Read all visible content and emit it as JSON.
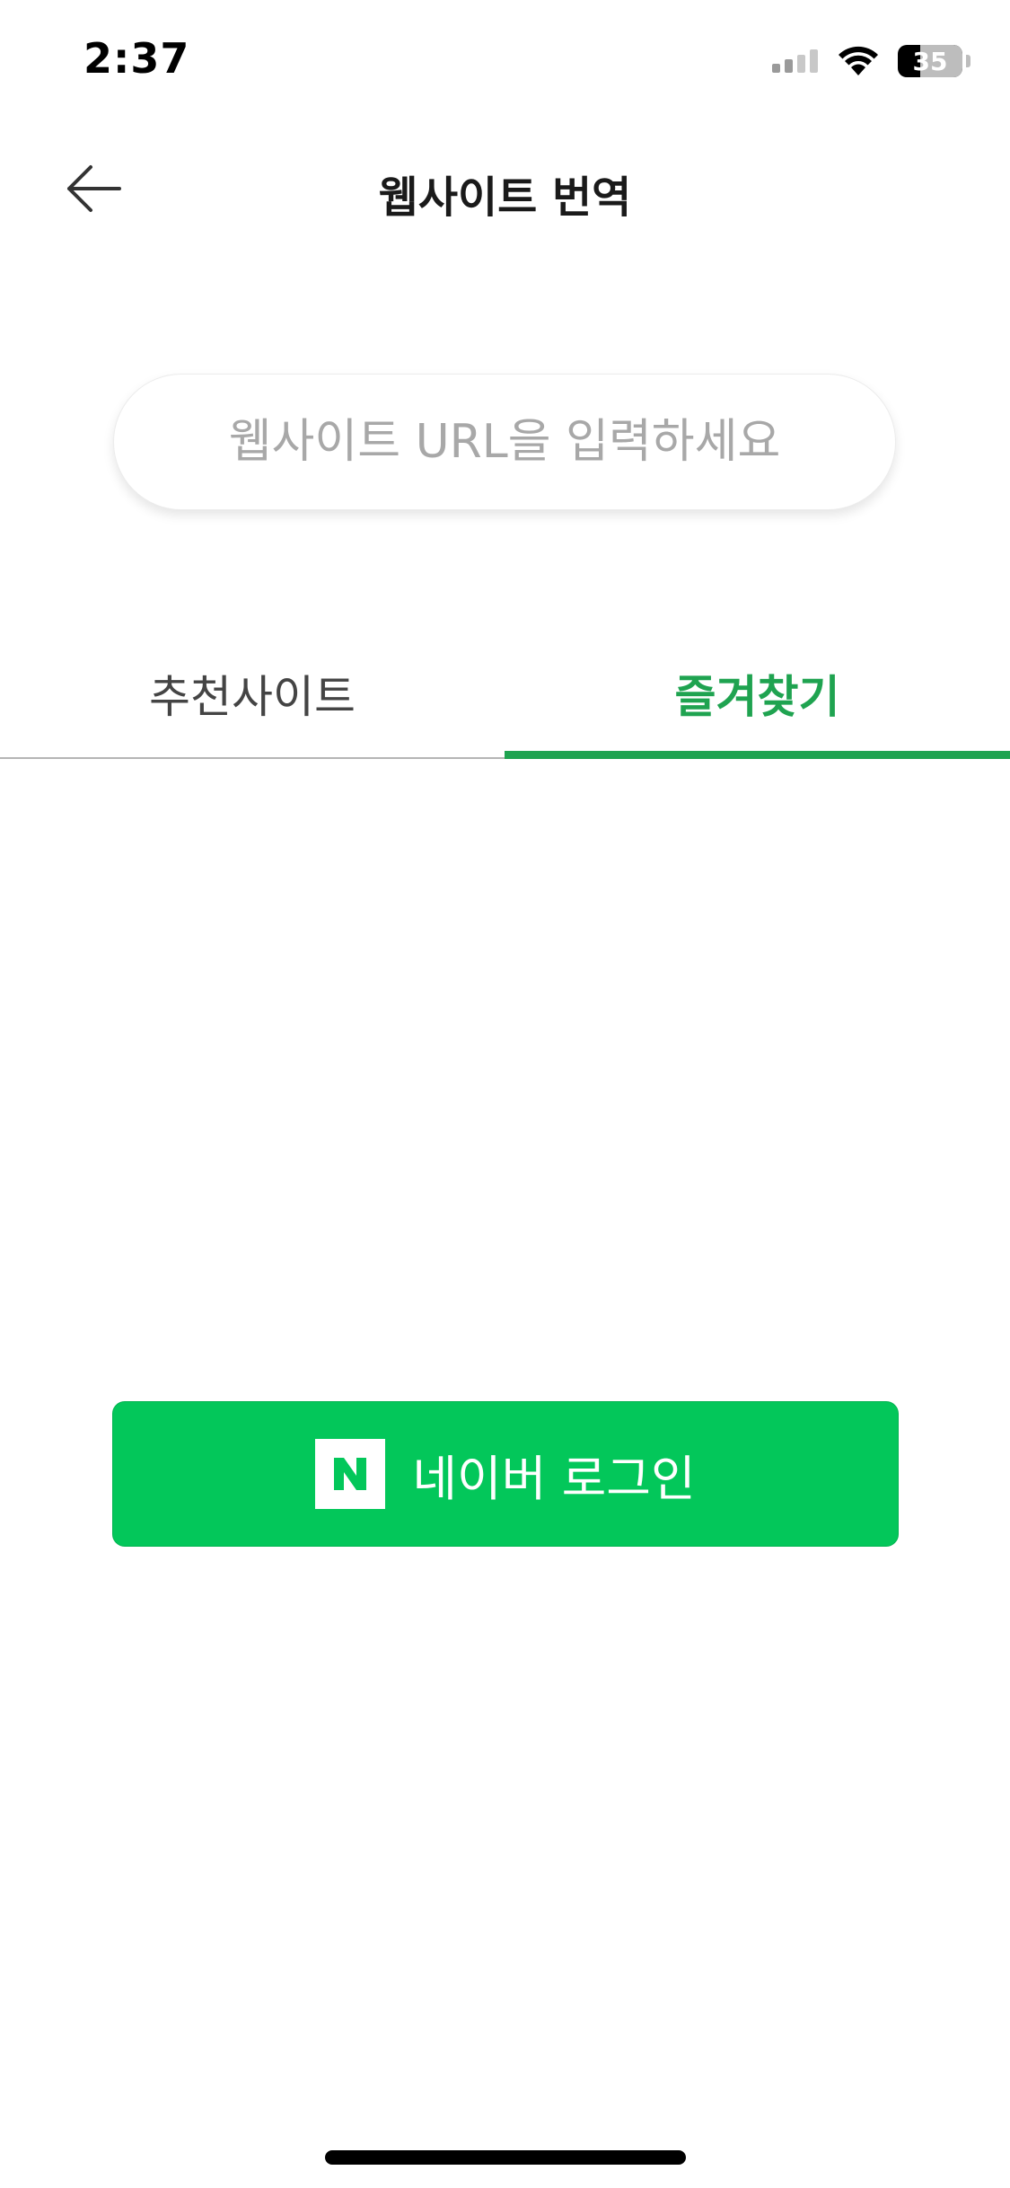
{
  "status_bar": {
    "time": "2:37",
    "battery_level": "35",
    "battery_percent": 35,
    "icons": [
      "cellular-signal-icon",
      "wifi-icon",
      "battery-icon"
    ]
  },
  "header": {
    "title": "웹사이트 번역",
    "back_icon": "arrow-left-icon"
  },
  "search": {
    "placeholder": "웹사이트 URL을 입력하세요",
    "value": ""
  },
  "tabs": [
    {
      "label": "추천사이트",
      "active": false
    },
    {
      "label": "즐겨찾기",
      "active": true
    }
  ],
  "login": {
    "label": "네이버 로그인",
    "logo_icon": "naver-n-logo-icon"
  },
  "colors": {
    "accent_green": "#1fa350",
    "naver_green": "#03c75a",
    "title_text": "#1a1a1a",
    "placeholder_text": "#a8a8a8",
    "tab_inactive_text": "#444444",
    "tab_divider": "#b5b5b5"
  }
}
